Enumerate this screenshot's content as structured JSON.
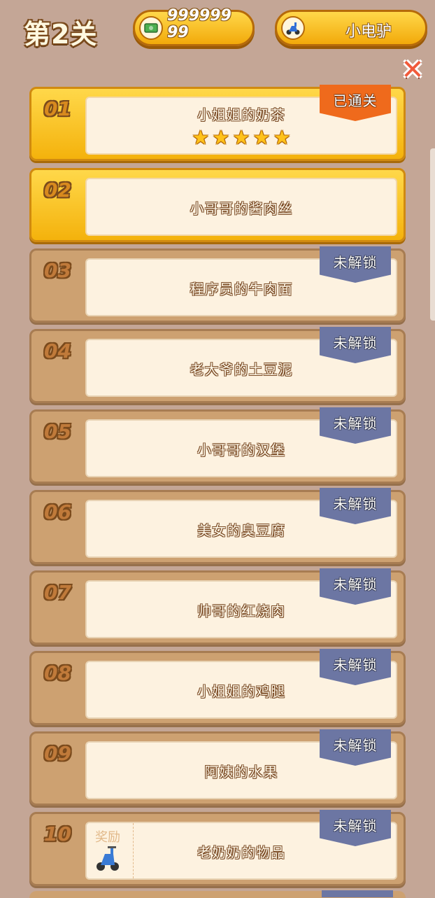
{
  "header": {
    "title": "第2关",
    "money": "99999999",
    "vehicle": "小电驴",
    "money_icon": "cash-icon",
    "vehicle_icon": "scooter-icon"
  },
  "levels": [
    {
      "num": "01",
      "name": "小姐姐的奶茶",
      "status": "已通关",
      "stars": 5
    },
    {
      "num": "02",
      "name": "小哥哥的酱肉丝",
      "status": "",
      "stars": 0
    },
    {
      "num": "03",
      "name": "程序员的牛肉面",
      "status": "未解锁",
      "stars": 0
    },
    {
      "num": "04",
      "name": "老大爷的土豆泥",
      "status": "未解锁",
      "stars": 0
    },
    {
      "num": "05",
      "name": "小哥哥的汉堡",
      "status": "未解锁",
      "stars": 0
    },
    {
      "num": "06",
      "name": "美女的臭豆腐",
      "status": "未解锁",
      "stars": 0
    },
    {
      "num": "07",
      "name": "帅哥的红烧肉",
      "status": "未解锁",
      "stars": 0
    },
    {
      "num": "08",
      "name": "小姐姐的鸡腿",
      "status": "未解锁",
      "stars": 0
    },
    {
      "num": "09",
      "name": "阿姨的水果",
      "status": "未解锁",
      "stars": 0
    },
    {
      "num": "10",
      "name": "老奶奶的物品",
      "status": "未解锁",
      "stars": 0,
      "reward": "奖励"
    }
  ],
  "colors": {
    "background": "#c4a696",
    "unlocked": "#ffd84a",
    "locked": "#cda171",
    "cleared_badge": "#ef6a1c",
    "locked_badge": "#6c76a3"
  }
}
